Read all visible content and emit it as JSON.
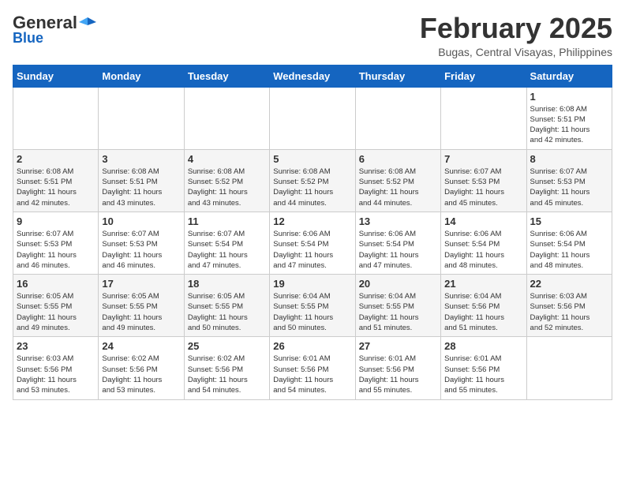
{
  "header": {
    "logo_general": "General",
    "logo_blue": "Blue",
    "month_title": "February 2025",
    "location": "Bugas, Central Visayas, Philippines"
  },
  "calendar": {
    "weekdays": [
      "Sunday",
      "Monday",
      "Tuesday",
      "Wednesday",
      "Thursday",
      "Friday",
      "Saturday"
    ],
    "weeks": [
      [
        {
          "day": "",
          "info": ""
        },
        {
          "day": "",
          "info": ""
        },
        {
          "day": "",
          "info": ""
        },
        {
          "day": "",
          "info": ""
        },
        {
          "day": "",
          "info": ""
        },
        {
          "day": "",
          "info": ""
        },
        {
          "day": "1",
          "info": "Sunrise: 6:08 AM\nSunset: 5:51 PM\nDaylight: 11 hours\nand 42 minutes."
        }
      ],
      [
        {
          "day": "2",
          "info": "Sunrise: 6:08 AM\nSunset: 5:51 PM\nDaylight: 11 hours\nand 42 minutes."
        },
        {
          "day": "3",
          "info": "Sunrise: 6:08 AM\nSunset: 5:51 PM\nDaylight: 11 hours\nand 43 minutes."
        },
        {
          "day": "4",
          "info": "Sunrise: 6:08 AM\nSunset: 5:52 PM\nDaylight: 11 hours\nand 43 minutes."
        },
        {
          "day": "5",
          "info": "Sunrise: 6:08 AM\nSunset: 5:52 PM\nDaylight: 11 hours\nand 44 minutes."
        },
        {
          "day": "6",
          "info": "Sunrise: 6:08 AM\nSunset: 5:52 PM\nDaylight: 11 hours\nand 44 minutes."
        },
        {
          "day": "7",
          "info": "Sunrise: 6:07 AM\nSunset: 5:53 PM\nDaylight: 11 hours\nand 45 minutes."
        },
        {
          "day": "8",
          "info": "Sunrise: 6:07 AM\nSunset: 5:53 PM\nDaylight: 11 hours\nand 45 minutes."
        }
      ],
      [
        {
          "day": "9",
          "info": "Sunrise: 6:07 AM\nSunset: 5:53 PM\nDaylight: 11 hours\nand 46 minutes."
        },
        {
          "day": "10",
          "info": "Sunrise: 6:07 AM\nSunset: 5:53 PM\nDaylight: 11 hours\nand 46 minutes."
        },
        {
          "day": "11",
          "info": "Sunrise: 6:07 AM\nSunset: 5:54 PM\nDaylight: 11 hours\nand 47 minutes."
        },
        {
          "day": "12",
          "info": "Sunrise: 6:06 AM\nSunset: 5:54 PM\nDaylight: 11 hours\nand 47 minutes."
        },
        {
          "day": "13",
          "info": "Sunrise: 6:06 AM\nSunset: 5:54 PM\nDaylight: 11 hours\nand 47 minutes."
        },
        {
          "day": "14",
          "info": "Sunrise: 6:06 AM\nSunset: 5:54 PM\nDaylight: 11 hours\nand 48 minutes."
        },
        {
          "day": "15",
          "info": "Sunrise: 6:06 AM\nSunset: 5:54 PM\nDaylight: 11 hours\nand 48 minutes."
        }
      ],
      [
        {
          "day": "16",
          "info": "Sunrise: 6:05 AM\nSunset: 5:55 PM\nDaylight: 11 hours\nand 49 minutes."
        },
        {
          "day": "17",
          "info": "Sunrise: 6:05 AM\nSunset: 5:55 PM\nDaylight: 11 hours\nand 49 minutes."
        },
        {
          "day": "18",
          "info": "Sunrise: 6:05 AM\nSunset: 5:55 PM\nDaylight: 11 hours\nand 50 minutes."
        },
        {
          "day": "19",
          "info": "Sunrise: 6:04 AM\nSunset: 5:55 PM\nDaylight: 11 hours\nand 50 minutes."
        },
        {
          "day": "20",
          "info": "Sunrise: 6:04 AM\nSunset: 5:55 PM\nDaylight: 11 hours\nand 51 minutes."
        },
        {
          "day": "21",
          "info": "Sunrise: 6:04 AM\nSunset: 5:56 PM\nDaylight: 11 hours\nand 51 minutes."
        },
        {
          "day": "22",
          "info": "Sunrise: 6:03 AM\nSunset: 5:56 PM\nDaylight: 11 hours\nand 52 minutes."
        }
      ],
      [
        {
          "day": "23",
          "info": "Sunrise: 6:03 AM\nSunset: 5:56 PM\nDaylight: 11 hours\nand 53 minutes."
        },
        {
          "day": "24",
          "info": "Sunrise: 6:02 AM\nSunset: 5:56 PM\nDaylight: 11 hours\nand 53 minutes."
        },
        {
          "day": "25",
          "info": "Sunrise: 6:02 AM\nSunset: 5:56 PM\nDaylight: 11 hours\nand 54 minutes."
        },
        {
          "day": "26",
          "info": "Sunrise: 6:01 AM\nSunset: 5:56 PM\nDaylight: 11 hours\nand 54 minutes."
        },
        {
          "day": "27",
          "info": "Sunrise: 6:01 AM\nSunset: 5:56 PM\nDaylight: 11 hours\nand 55 minutes."
        },
        {
          "day": "28",
          "info": "Sunrise: 6:01 AM\nSunset: 5:56 PM\nDaylight: 11 hours\nand 55 minutes."
        },
        {
          "day": "",
          "info": ""
        }
      ]
    ]
  }
}
